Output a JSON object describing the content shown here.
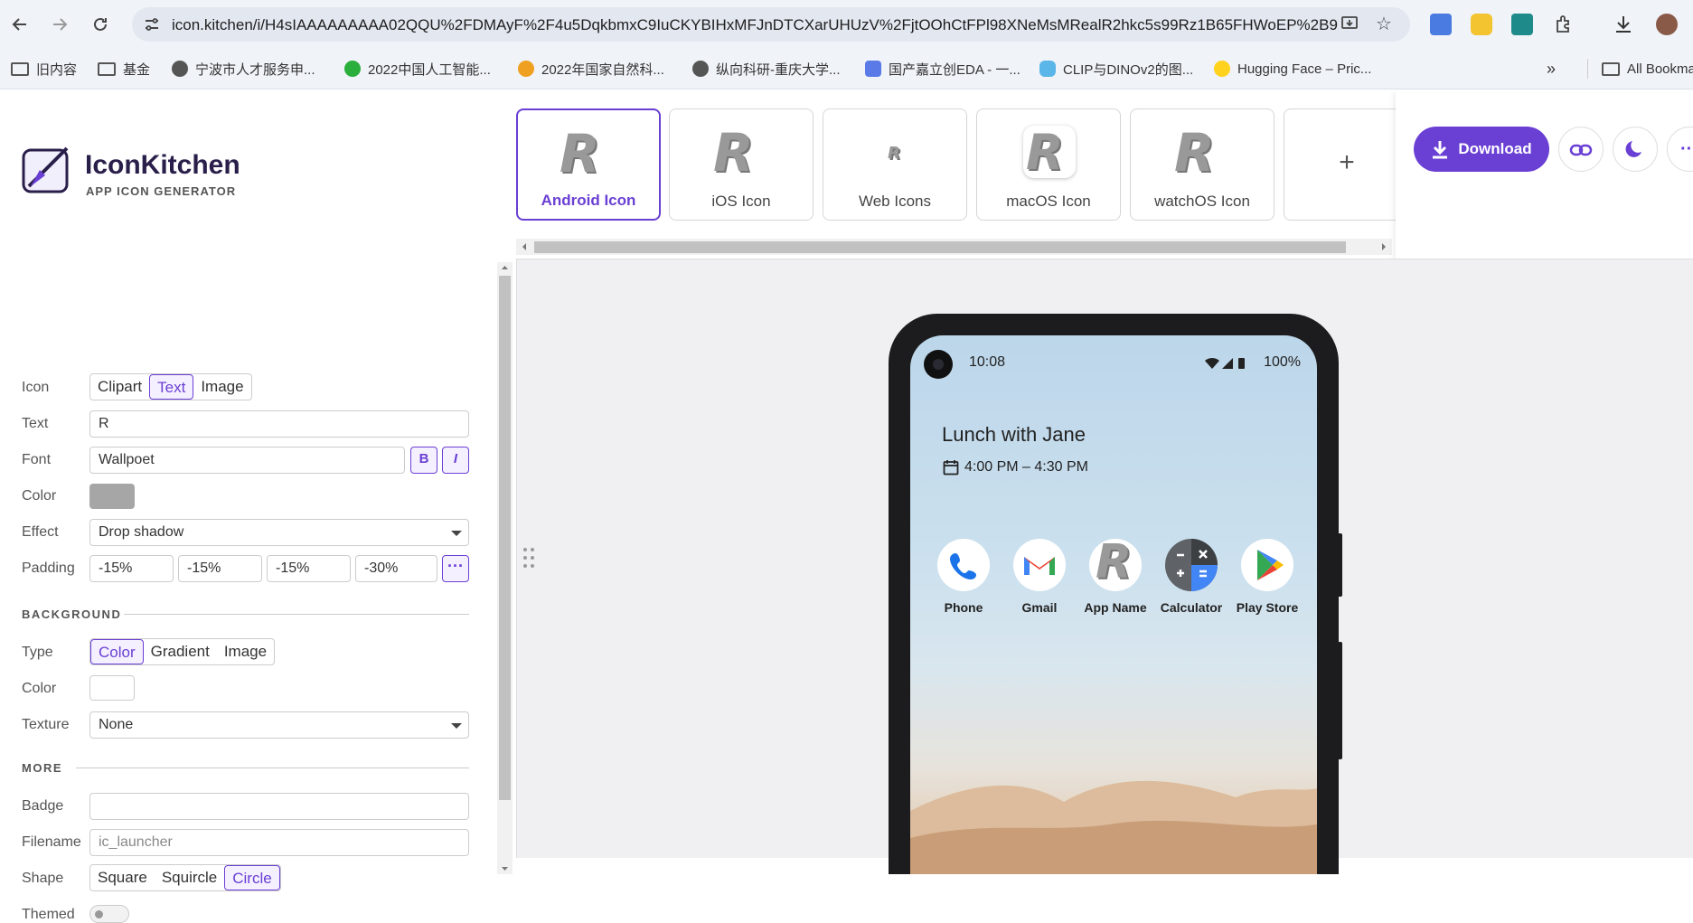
{
  "browser": {
    "url": "icon.kitchen/i/H4sIAAAAAAAAA02QQU%2FDMAyF%2F4u5DqkbmxC9IuCKYBIHxMFJnDTCXarUHUzV%2FjtOOhCtFPl98XNeMsMRealR2hkc5s99Rz1B65FHWoEP%2B9...",
    "bookmarks": [
      {
        "label": "旧内容",
        "icon": "folder-icon"
      },
      {
        "label": "基金",
        "icon": "folder-icon"
      },
      {
        "label": "宁波市人才服务申...",
        "icon": "globe-icon"
      },
      {
        "label": "2022中国人工智能...",
        "icon": "wechat-icon"
      },
      {
        "label": "2022年国家自然科...",
        "icon": "p-icon"
      },
      {
        "label": "纵向科研-重庆大学...",
        "icon": "globe-icon"
      },
      {
        "label": "国产嘉立创EDA - 一...",
        "icon": "eda-icon"
      },
      {
        "label": "CLIP与DINOv2的图...",
        "icon": "cloud-icon"
      },
      {
        "label": "Hugging Face – Pric...",
        "icon": "hf-icon"
      }
    ],
    "all_bookmarks": "All Bookmarks"
  },
  "brand": {
    "title": "IconKitchen",
    "subtitle": "APP ICON GENERATOR"
  },
  "tabs": [
    {
      "label": "Android Icon",
      "selected": true
    },
    {
      "label": "iOS Icon",
      "selected": false
    },
    {
      "label": "Web Icons",
      "selected": false
    },
    {
      "label": "macOS Icon",
      "selected": false
    },
    {
      "label": "watchOS Icon",
      "selected": false
    },
    {
      "label": "+",
      "selected": false
    }
  ],
  "tab_glyph": "R",
  "actions": {
    "download": "Download"
  },
  "sidebar": {
    "icon_label": "Icon",
    "icon_options": [
      "Clipart",
      "Text",
      "Image"
    ],
    "icon_selected": "Text",
    "text_label": "Text",
    "text_value": "R",
    "font_label": "Font",
    "font_value": "Wallpoet",
    "bold_btn": "B",
    "italic_btn": "I",
    "color_label": "Color",
    "color_value": "#a6a6a6",
    "effect_label": "Effect",
    "effect_value": "Drop shadow",
    "padding_label": "Padding",
    "padding_values": [
      "-15%",
      "-15%",
      "-15%",
      "-30%"
    ],
    "background_title": "BACKGROUND",
    "type_label": "Type",
    "type_options": [
      "Color",
      "Gradient",
      "Image"
    ],
    "type_selected": "Color",
    "bg_color_label": "Color",
    "bg_color_value": "#ffffff",
    "texture_label": "Texture",
    "texture_value": "None",
    "more_title": "MORE",
    "badge_label": "Badge",
    "badge_value": "",
    "filename_label": "Filename",
    "filename_placeholder": "ic_launcher",
    "shape_label": "Shape",
    "shape_options": [
      "Square",
      "Squircle",
      "Circle"
    ],
    "shape_selected": "Circle",
    "themed_label": "Themed",
    "themed_on": false
  },
  "phone": {
    "time": "10:08",
    "battery": "100%",
    "event_title": "Lunch with Jane",
    "event_time": "4:00 PM – 4:30 PM",
    "apps": [
      {
        "label": "Phone",
        "icon": "phone-icon"
      },
      {
        "label": "Gmail",
        "icon": "gmail-icon"
      },
      {
        "label": "App Name",
        "icon": "app-r-icon"
      },
      {
        "label": "Calculator",
        "icon": "calculator-icon"
      },
      {
        "label": "Play Store",
        "icon": "play-store-icon"
      }
    ]
  },
  "colors": {
    "accent": "#6a3fd4",
    "brand_dark": "#2a1f4a"
  }
}
